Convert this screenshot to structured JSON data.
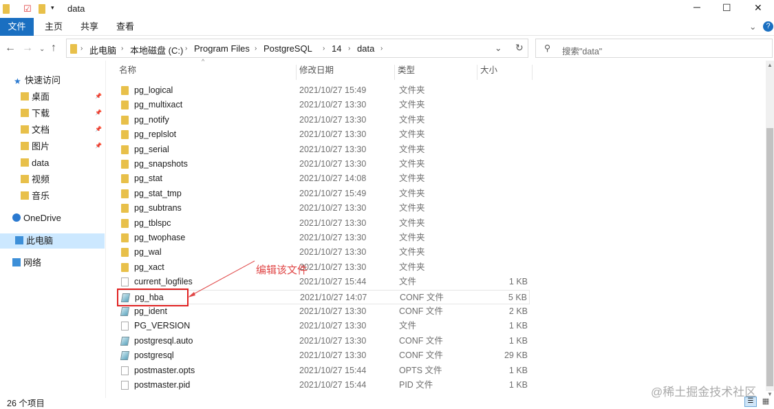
{
  "window": {
    "title": "data",
    "controls": [
      "─",
      "☐",
      "✕"
    ]
  },
  "ribbon": {
    "tabs": [
      "文件",
      "主页",
      "共享",
      "查看"
    ]
  },
  "address": {
    "crumbs": [
      "此电脑",
      "本地磁盘 (C:)",
      "Program Files",
      "PostgreSQL",
      "14",
      "data"
    ],
    "search_placeholder": "搜索\"data\""
  },
  "sidebar": {
    "items": [
      {
        "label": "快速访问",
        "icon": "star-icon",
        "pinned": false
      },
      {
        "label": "桌面",
        "icon": "desktop-folder-icon",
        "pinned": true
      },
      {
        "label": "下载",
        "icon": "download-folder-icon",
        "pinned": true
      },
      {
        "label": "文档",
        "icon": "documents-folder-icon",
        "pinned": true
      },
      {
        "label": "图片",
        "icon": "pictures-folder-icon",
        "pinned": true
      },
      {
        "label": "data",
        "icon": "folder-icon",
        "pinned": false
      },
      {
        "label": "视频",
        "icon": "videos-folder-icon",
        "pinned": false
      },
      {
        "label": "音乐",
        "icon": "music-folder-icon",
        "pinned": false
      },
      {
        "label": "OneDrive",
        "icon": "cloud-icon",
        "pinned": false
      },
      {
        "label": "此电脑",
        "icon": "computer-icon",
        "pinned": false,
        "selected": true
      },
      {
        "label": "网络",
        "icon": "network-icon",
        "pinned": false
      }
    ]
  },
  "columns": [
    "名称",
    "修改日期",
    "类型",
    "大小"
  ],
  "files": [
    {
      "name": "pg_logical",
      "date": "2021/10/27 15:49",
      "type": "文件夹",
      "size": "",
      "kind": "folder"
    },
    {
      "name": "pg_multixact",
      "date": "2021/10/27 13:30",
      "type": "文件夹",
      "size": "",
      "kind": "folder"
    },
    {
      "name": "pg_notify",
      "date": "2021/10/27 13:30",
      "type": "文件夹",
      "size": "",
      "kind": "folder"
    },
    {
      "name": "pg_replslot",
      "date": "2021/10/27 13:30",
      "type": "文件夹",
      "size": "",
      "kind": "folder"
    },
    {
      "name": "pg_serial",
      "date": "2021/10/27 13:30",
      "type": "文件夹",
      "size": "",
      "kind": "folder"
    },
    {
      "name": "pg_snapshots",
      "date": "2021/10/27 13:30",
      "type": "文件夹",
      "size": "",
      "kind": "folder"
    },
    {
      "name": "pg_stat",
      "date": "2021/10/27 14:08",
      "type": "文件夹",
      "size": "",
      "kind": "folder"
    },
    {
      "name": "pg_stat_tmp",
      "date": "2021/10/27 15:49",
      "type": "文件夹",
      "size": "",
      "kind": "folder"
    },
    {
      "name": "pg_subtrans",
      "date": "2021/10/27 13:30",
      "type": "文件夹",
      "size": "",
      "kind": "folder"
    },
    {
      "name": "pg_tblspc",
      "date": "2021/10/27 13:30",
      "type": "文件夹",
      "size": "",
      "kind": "folder"
    },
    {
      "name": "pg_twophase",
      "date": "2021/10/27 13:30",
      "type": "文件夹",
      "size": "",
      "kind": "folder"
    },
    {
      "name": "pg_wal",
      "date": "2021/10/27 13:30",
      "type": "文件夹",
      "size": "",
      "kind": "folder"
    },
    {
      "name": "pg_xact",
      "date": "2021/10/27 13:30",
      "type": "文件夹",
      "size": "",
      "kind": "folder"
    },
    {
      "name": "current_logfiles",
      "date": "2021/10/27 15:44",
      "type": "文件",
      "size": "1 KB",
      "kind": "file"
    },
    {
      "name": "pg_hba",
      "date": "2021/10/27 14:07",
      "type": "CONF 文件",
      "size": "5 KB",
      "kind": "conf",
      "highlighted": true
    },
    {
      "name": "pg_ident",
      "date": "2021/10/27 13:30",
      "type": "CONF 文件",
      "size": "2 KB",
      "kind": "conf"
    },
    {
      "name": "PG_VERSION",
      "date": "2021/10/27 13:30",
      "type": "文件",
      "size": "1 KB",
      "kind": "file"
    },
    {
      "name": "postgresql.auto",
      "date": "2021/10/27 13:30",
      "type": "CONF 文件",
      "size": "1 KB",
      "kind": "conf"
    },
    {
      "name": "postgresql",
      "date": "2021/10/27 13:30",
      "type": "CONF 文件",
      "size": "29 KB",
      "kind": "conf"
    },
    {
      "name": "postmaster.opts",
      "date": "2021/10/27 15:44",
      "type": "OPTS 文件",
      "size": "1 KB",
      "kind": "file"
    },
    {
      "name": "postmaster.pid",
      "date": "2021/10/27 15:44",
      "type": "PID 文件",
      "size": "1 KB",
      "kind": "file"
    }
  ],
  "annotation": "编辑该文件",
  "status": {
    "count": "26 个项目"
  },
  "watermark": "@稀土掘金技术社区"
}
